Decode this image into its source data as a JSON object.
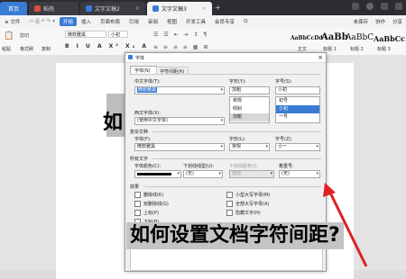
{
  "tabs": {
    "home": "首页",
    "daoke": "稻壳",
    "doc2": "文字文稿2",
    "doc3": "文字文稿3",
    "add": "+"
  },
  "menu": {
    "file": "≡ 文件",
    "items": [
      "开始",
      "插入",
      "页面布局",
      "引用",
      "审阅",
      "视图",
      "开发工具",
      "会员专享"
    ],
    "active": "开始",
    "search": "Q",
    "cowork": "未保存",
    "collab": "协作",
    "share": "分享"
  },
  "ribbon": {
    "paste": "粘贴",
    "cut": "剪切",
    "format": "格式刷",
    "copy": "复制",
    "font": "微软雅黑",
    "size": "小初",
    "style_samples": [
      "AaBbCcDd",
      "AaBb",
      "AaBbC",
      "AaBbCc"
    ],
    "style_labels": [
      "正文",
      "标题 1",
      "标题 2",
      "标题 3"
    ]
  },
  "document": {
    "char": "如",
    "heading": "如何设置文档字符间距?"
  },
  "dialog": {
    "title": "字体",
    "close": "×",
    "tabs": [
      "字体(N)",
      "字符间距(R)"
    ],
    "cn_font_label": "中文字体(T):",
    "cn_font": "微软雅黑",
    "style_label": "字形(Y):",
    "style_value": "加粗",
    "size_label": "字号(S):",
    "size_value": "小初",
    "style_list": [
      "常规",
      "倾斜",
      "加粗"
    ],
    "size_list": [
      "初号",
      "小初",
      "一号"
    ],
    "west_font_label": "西文字体(X):",
    "west_font": "(使用中文字体)",
    "complex_section": "复杂文种",
    "cx_font_label": "字体(F):",
    "cx_font": "微软雅黑",
    "cx_style_label": "字形(L):",
    "cx_style": "常规",
    "cx_size_label": "字号(Z):",
    "cx_size": "小一",
    "all_text_section": "所有文字",
    "color_label": "字体颜色(C):",
    "underline_label": "下划线线型(U):",
    "underline": "(无)",
    "ucolor_label": "下划线颜色(I):",
    "ucolor": "自动",
    "emph_label": "着重号:",
    "emph": "(无)",
    "effects_section": "效果",
    "effects_left": [
      "删除线(K)",
      "双删除线(G)",
      "上标(P)",
      "下标(B)"
    ],
    "effects_right": [
      "小型大写字母(M)",
      "全部大写字母(A)",
      "隐藏文字(H)"
    ],
    "preview_section": "预览",
    "preview_text": "如何设置文档字符间距?"
  }
}
